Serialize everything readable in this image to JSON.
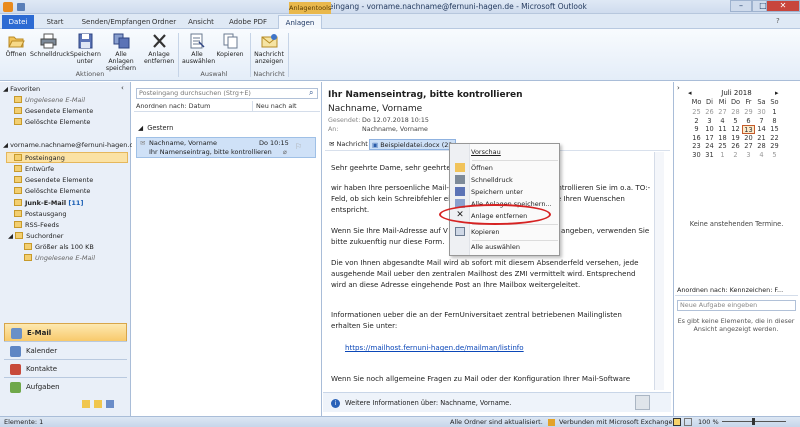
{
  "window": {
    "title": "Posteingang - vorname.nachname@fernuni-hagen.de - Microsoft Outlook",
    "context_tab": "Anlagentools",
    "min": "–",
    "max": "□",
    "close": "✕"
  },
  "tabs": [
    "Datei",
    "Start",
    "Senden/Empfangen",
    "Ordner",
    "Ansicht",
    "Adobe PDF",
    "Anlagen"
  ],
  "ribbon": {
    "actions": [
      {
        "label": "Öffnen",
        "icon": "open-folder-icon"
      },
      {
        "label": "Schnelldruck",
        "icon": "printer-icon"
      },
      {
        "label": "Speichern unter",
        "icon": "save-as-icon"
      },
      {
        "label": "Alle Anlagen speichern",
        "icon": "save-all-icon"
      },
      {
        "label": "Anlage entfernen",
        "icon": "remove-x-icon"
      }
    ],
    "group_actions": "Aktionen",
    "select": [
      {
        "label": "Alle auswählen",
        "icon": "select-all-icon"
      },
      {
        "label": "Kopieren",
        "icon": "copy-icon"
      }
    ],
    "group_select": "Auswahl",
    "message": {
      "label": "Nachricht anzeigen",
      "icon": "show-message-icon"
    },
    "group_message": "Nachricht"
  },
  "nav": {
    "favorites": "Favoriten",
    "fav_items": [
      "Ungelesene E-Mail",
      "Gesendete Elemente",
      "Gelöschte Elemente"
    ],
    "account": "vorname.nachname@fernuni-hagen.d...",
    "folders": [
      "Posteingang",
      "Entwürfe",
      "Gesendete Elemente",
      "Gelöschte Elemente"
    ],
    "junk": "Junk-E-Mail",
    "junk_count": "[11]",
    "more": [
      "Postausgang",
      "RSS-Feeds"
    ],
    "search_folder": "Suchordner",
    "search_items": [
      "Größer als 100 KB",
      "Ungelesene E-Mail"
    ],
    "big": [
      "E-Mail",
      "Kalender",
      "Kontakte",
      "Aufgaben"
    ]
  },
  "list": {
    "search_placeholder": "Posteingang durchsuchen (Strg+E)",
    "sort": "Anordnen nach: Datum",
    "order": "Neu nach alt",
    "group": "Gestern",
    "mail": {
      "sender": "Nachname, Vorname",
      "time": "Do 10:15",
      "subject": "Ihr Namenseintrag, bitte kontrollieren"
    }
  },
  "reading": {
    "subject": "Ihr Namenseintrag, bitte kontrollieren",
    "from": "Nachname, Vorname",
    "sent_label": "Gesendet:",
    "sent": "Do 12.07.2018 10:15",
    "to_label": "An:",
    "to": "Nachname, Vorname",
    "msg_tab": "Nachricht",
    "attachment": "Beispieldatei.docx (22",
    "p0": "Sehr geehrte Dame, sehr geehrte",
    "p1a": "wir haben Ihre persoenliche Mail-",
    "p1b": "ontrollieren Sie im o.a. TO:-",
    "p1c": "Feld, ob sich kein Schreibfehler ei",
    "p1d": "se Ihren Wuenschen",
    "p1e": "entspricht.",
    "p2a": "Wenn Sie Ihre Mail-Adresse auf V",
    "p2b": "angeben, verwenden Sie",
    "p2c": "bitte zukuenftig nur diese Form.",
    "p3": [
      "Die von Ihnen abgesandte Mail wird ab sofort mit diesem Absenderfeld versehen, jede",
      "ausgehende Mail ueber den zentralen Mailhost des ZMI vermittelt wird. Entsprechend",
      "wird an diese Adresse eingehende Post an Ihre Mailbox weitergeleitet."
    ],
    "p4": [
      "Informationen ueber die an der FernUniversitaet zentral betriebenen Mailinglisten",
      "erhalten Sie unter:"
    ],
    "link": "https://mailhost.fernuni-hagen.de/mailman/listinfo",
    "p5": "Wenn Sie noch allgemeine Fragen zu Mail oder der Konfiguration Ihrer Mail-Software",
    "people": "Weitere Informationen über: Nachname, Vorname."
  },
  "context_menu": [
    "Vorschau",
    "Öffnen",
    "Schnelldruck",
    "Speichern unter",
    "Alle Anlagen speichern...",
    "Anlage entfernen",
    "Kopieren",
    "Alle auswählen"
  ],
  "todo": {
    "month": "Juli 2018",
    "weekdays": [
      "Mo",
      "Di",
      "Mi",
      "Do",
      "Fr",
      "Sa",
      "So"
    ],
    "weeks": [
      [
        "25",
        "26",
        "27",
        "28",
        "29",
        "30",
        "1"
      ],
      [
        "2",
        "3",
        "4",
        "5",
        "6",
        "7",
        "8"
      ],
      [
        "9",
        "10",
        "11",
        "12",
        "13",
        "14",
        "15"
      ],
      [
        "16",
        "17",
        "18",
        "19",
        "20",
        "21",
        "22"
      ],
      [
        "23",
        "24",
        "25",
        "26",
        "27",
        "28",
        "29"
      ],
      [
        "30",
        "31",
        "1",
        "2",
        "3",
        "4",
        "5"
      ]
    ],
    "today": "13",
    "no_appointments": "Keine anstehenden Termine.",
    "tasks_sort": "Anordnen nach: Kennzeichen: F...",
    "new_task": "Neue Aufgabe eingeben",
    "no_tasks": "Es gibt keine Elemente, die in dieser Ansicht angezeigt werden."
  },
  "status": {
    "items": "Elemente: 1",
    "updated": "Alle Ordner sind aktualisiert.",
    "connected": "Verbunden mit Microsoft Exchange",
    "zoom": "100 %"
  }
}
